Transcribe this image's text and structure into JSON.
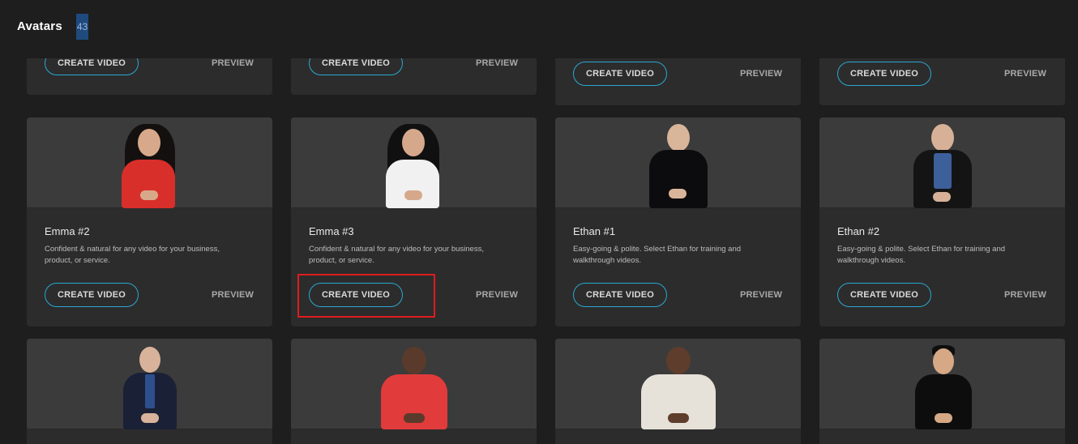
{
  "header": {
    "title": "Avatars",
    "count": "43"
  },
  "labels": {
    "create": "CREATE VIDEO",
    "preview": "PREVIEW"
  },
  "cards": [
    {
      "name": "Emma #2",
      "description": "Confident & natural for any video for your business, product, or service."
    },
    {
      "name": "Emma #3",
      "description": "Confident & natural for any video for your business, product, or service."
    },
    {
      "name": "Ethan #1",
      "description": "Easy-going & polite. Select Ethan for training and walkthrough videos."
    },
    {
      "name": "Ethan #2",
      "description": "Easy-going & polite. Select Ethan for training and walkthrough videos."
    }
  ],
  "colors": {
    "accent": "#2aa8d2",
    "highlight": "#e01b1b",
    "count_badge": "#1f4a7e"
  }
}
